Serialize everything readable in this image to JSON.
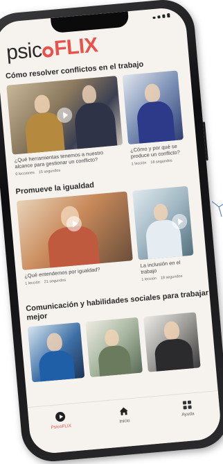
{
  "app": {
    "logo_prefix": "psic",
    "logo_suffix": "FLIX"
  },
  "sections": [
    {
      "title": "Cómo resolver conflictos en el trabajo",
      "cards": [
        {
          "title": "¿Qué herramientas tenemos a nuestro alcance para gestionar un conflicto?",
          "meta_a": "6 lecciones",
          "meta_b": "15 segundos"
        },
        {
          "title": "¿Cómo y por qué se produce un conflicto?",
          "meta_a": "1 lección",
          "meta_b": "18 segundos"
        }
      ]
    },
    {
      "title": "Promueve la igualdad",
      "cards": [
        {
          "title": "¿Qué entendemos por igualdad?",
          "meta_a": "1 lección",
          "meta_b": "21 segundos"
        },
        {
          "title": "La inclusión en el trabajo",
          "meta_a": "1 lección",
          "meta_b": "18 segundos"
        }
      ]
    },
    {
      "title": "Comunicación y habilidades sociales para trabajar mejor",
      "cards": []
    }
  ],
  "nav": [
    {
      "label": "PsicoFLIX",
      "icon": "play-icon",
      "active": true
    },
    {
      "label": "Inicio",
      "icon": "home-icon",
      "active": false
    },
    {
      "label": "Ayuda",
      "icon": "grid-icon",
      "active": false
    }
  ],
  "colors": {
    "brand": "#e8524a",
    "text": "#2a2a2a",
    "screen_bg": "#f6f3ee",
    "phone_frame": "#1c1c1e"
  }
}
